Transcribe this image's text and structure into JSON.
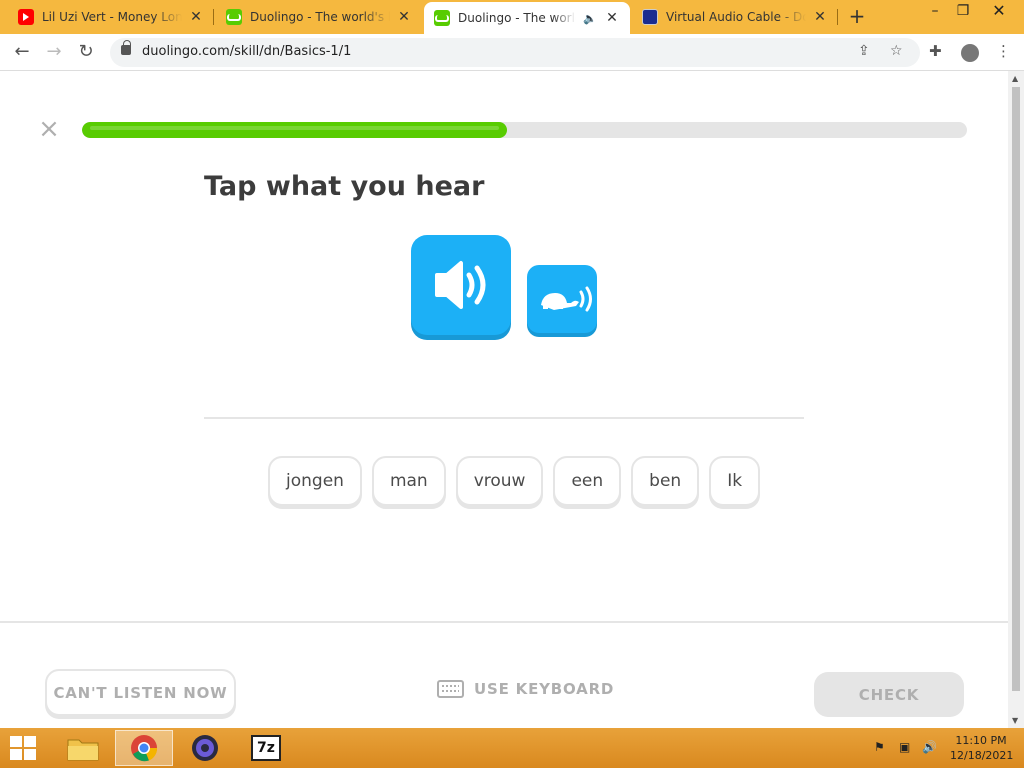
{
  "browser": {
    "tabs": [
      {
        "title": "Lil Uzi Vert - Money Longer",
        "icon": "youtube-icon",
        "active": false
      },
      {
        "title": "Duolingo - The world's best",
        "icon": "duolingo-icon",
        "active": false
      },
      {
        "title": "Duolingo - The world's",
        "icon": "duolingo-icon",
        "active": true,
        "audio": true
      },
      {
        "title": "Virtual Audio Cable - Down",
        "icon": "vac-icon",
        "active": false
      }
    ],
    "url": "duolingo.com/skill/dn/Basics-1/1"
  },
  "lesson": {
    "progress": 0.48,
    "heading": "Tap what you hear",
    "word_bank": [
      "jongen",
      "man",
      "vrouw",
      "een",
      "ben",
      "Ik"
    ],
    "footer": {
      "cant_listen": "CAN'T LISTEN NOW",
      "use_keyboard": "USE KEYBOARD",
      "check": "CHECK"
    }
  },
  "taskbar": {
    "apps": [
      "file-explorer",
      "chrome",
      "obs",
      "7zip"
    ],
    "time": "11:10 PM",
    "date": "12/18/2021"
  },
  "colors": {
    "accent_green": "#58cc02",
    "accent_blue": "#1cb0f6",
    "tab_strip": "#f5b83f"
  }
}
